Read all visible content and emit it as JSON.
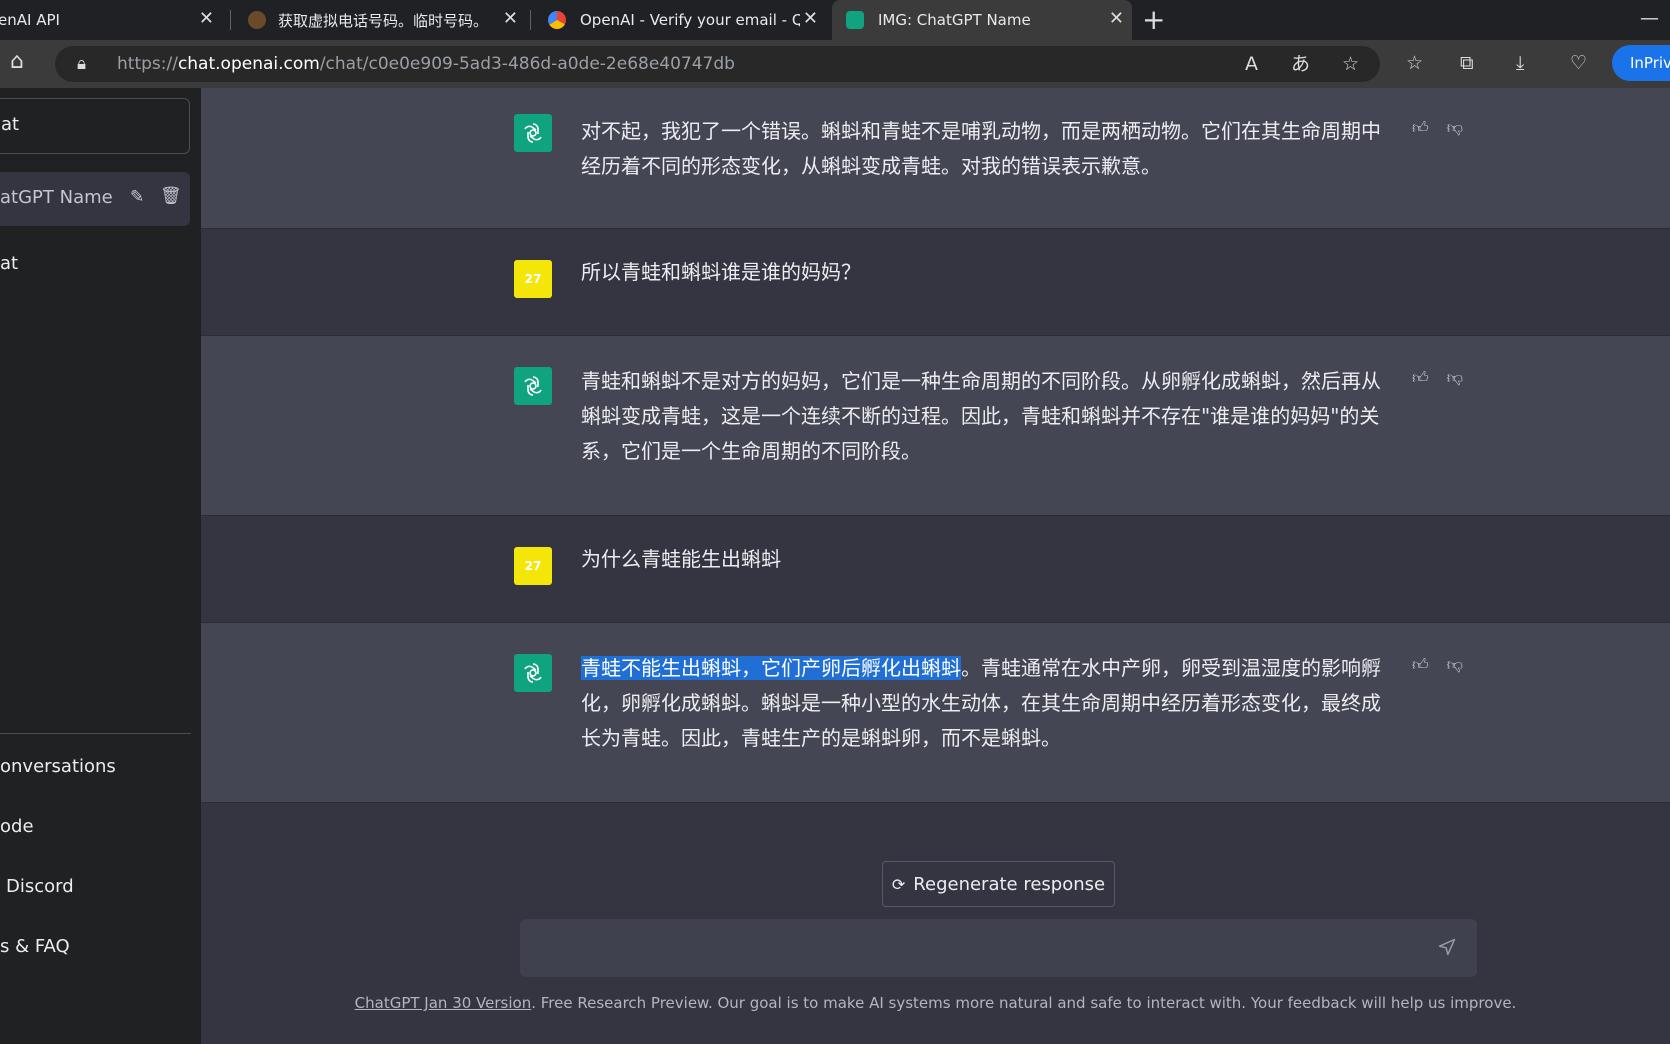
{
  "browser": {
    "tabs": [
      {
        "title": "enAI API"
      },
      {
        "title": "获取虚拟电话号码。临时号码。"
      },
      {
        "title": "OpenAI - Verify your email - QQ"
      },
      {
        "title": "IMG: ChatGPT Name"
      }
    ],
    "new_tab_label": "+",
    "window_min_label": "—",
    "url_prefix": "https://",
    "url_host": "chat.openai.com",
    "url_path": "/chat/c0e0e909-5ad3-486d-a0de-2e68e40747db",
    "inprivate_label": "InPrivate"
  },
  "sidebar": {
    "new_chat_label": "at",
    "chats": [
      {
        "label": "atGPT Name"
      },
      {
        "label": "at"
      }
    ],
    "bottom_items": [
      {
        "label": "onversations"
      },
      {
        "label": "ode"
      },
      {
        "label": "Discord"
      },
      {
        "label": "s & FAQ"
      },
      {
        "label": ""
      }
    ]
  },
  "conversation": {
    "user_avatar_text": "27",
    "messages": [
      {
        "role": "assistant",
        "text": "对不起，我犯了一个错误。蝌蚪和青蛙不是哺乳动物，而是两栖动物。它们在其生命周期中经历着不同的形态变化，从蝌蚪变成青蛙。对我的错误表示歉意。"
      },
      {
        "role": "user",
        "text": "所以青蛙和蝌蚪谁是谁的妈妈？"
      },
      {
        "role": "assistant",
        "text": "青蛙和蝌蚪不是对方的妈妈，它们是一种生命周期的不同阶段。从卵孵化成蝌蚪，然后再从蝌蚪变成青蛙，这是一个连续不断的过程。因此，青蛙和蝌蚪并不存在\"谁是谁的妈妈\"的关系，它们是一个生命周期的不同阶段。"
      },
      {
        "role": "user",
        "text": "为什么青蛙能生出蝌蚪"
      },
      {
        "role": "assistant",
        "highlighted_text": "青蛙不能生出蝌蚪，它们产卵后孵化出蝌蚪",
        "text": "。青蛙通常在水中产卵，卵受到温湿度的影响孵化，卵孵化成蝌蚪。蝌蚪是一种小型的水生动体，在其生命周期中经历着形态变化，最终成长为青蛙。因此，青蛙生产的是蝌蚪卵，而不是蝌蚪。"
      }
    ],
    "regenerate_label": "Regenerate response",
    "input_placeholder": ""
  },
  "footer": {
    "version_link": "ChatGPT Jan 30 Version",
    "text": ". Free Research Preview. Our goal is to make AI systems more natural and safe to interact with. Your feedback will help us improve."
  },
  "colors": {
    "main_bg": "#343541",
    "assistant_bg": "#444654",
    "sidebar_bg": "#202123",
    "gpt_green": "#10a37f",
    "user_avatar": "#f5e60a",
    "highlight": "#1f6fd6"
  }
}
